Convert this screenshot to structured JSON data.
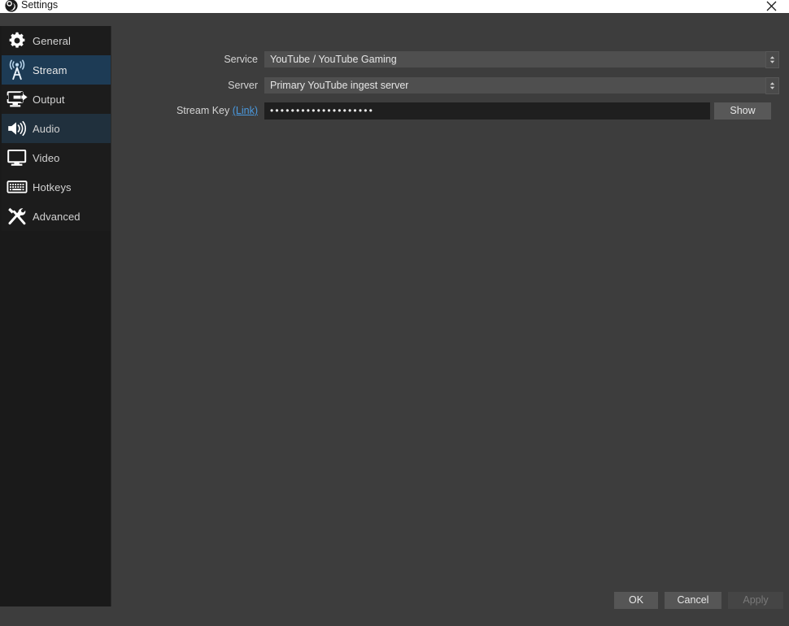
{
  "window": {
    "title": "Settings",
    "app_icon": "obs-logo-icon",
    "close_icon": "close-icon"
  },
  "sidebar": {
    "items": [
      {
        "label": "General",
        "icon": "gear-icon",
        "state": "normal"
      },
      {
        "label": "Stream",
        "icon": "broadcast-tower-icon",
        "state": "selected"
      },
      {
        "label": "Output",
        "icon": "monitor-arrow-icon",
        "state": "normal"
      },
      {
        "label": "Audio",
        "icon": "speaker-icon",
        "state": "hover"
      },
      {
        "label": "Video",
        "icon": "monitor-icon",
        "state": "normal"
      },
      {
        "label": "Hotkeys",
        "icon": "keyboard-icon",
        "state": "normal"
      },
      {
        "label": "Advanced",
        "icon": "wrench-screwdriver-icon",
        "state": "normal"
      }
    ]
  },
  "stream_settings": {
    "service": {
      "label": "Service",
      "value": "YouTube / YouTube Gaming",
      "spinner_icon": "updown-chevron-icon"
    },
    "server": {
      "label": "Server",
      "value": "Primary YouTube ingest server",
      "spinner_icon": "updown-chevron-icon"
    },
    "stream_key": {
      "label": "Stream Key",
      "link_label": "(Link)",
      "value": "••••••••••••••••••••",
      "show_button": "Show"
    }
  },
  "footer": {
    "ok": "OK",
    "cancel": "Cancel",
    "apply": "Apply"
  },
  "colors": {
    "accent_selected": "#1d3b55",
    "link": "#4a9ae0",
    "sidebar_bg": "#1a1a1a",
    "main_bg": "#3d3d3d",
    "combo_bg": "#4f4f4f",
    "lineedit_bg": "#1f1f1f"
  }
}
